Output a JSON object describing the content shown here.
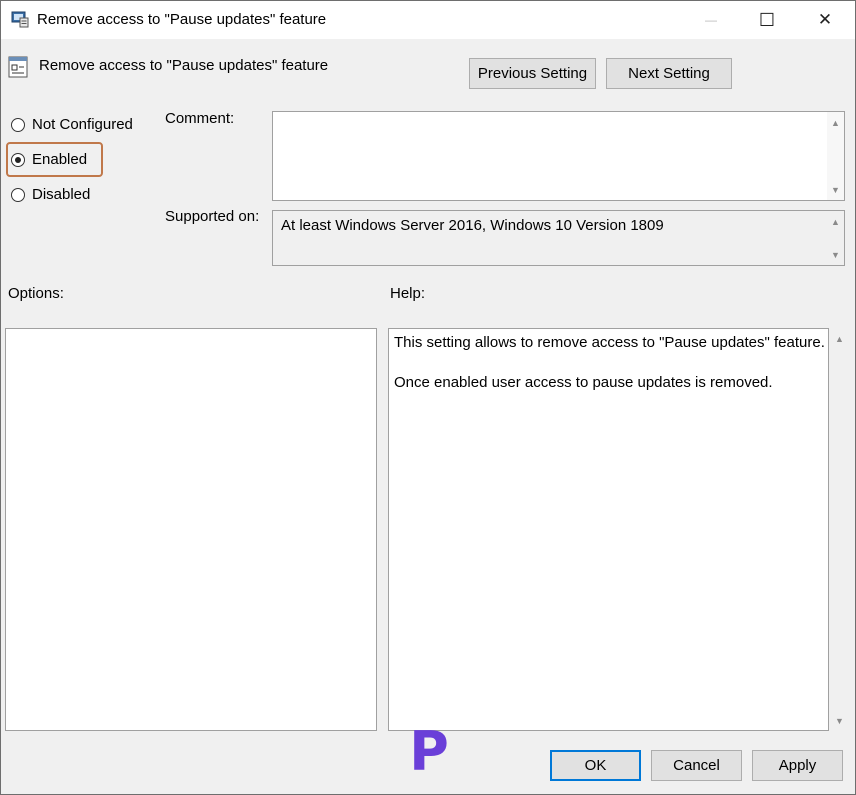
{
  "window": {
    "title": "Remove access to \"Pause updates\" feature",
    "minimize_glyph": "—",
    "maximize_glyph": "☐",
    "close_glyph": "✕",
    "icon": "policy-settings-icon"
  },
  "header": {
    "title": "Remove access to \"Pause updates\" feature",
    "icon": "policy-setting-icon"
  },
  "nav": {
    "previous_label": "Previous Setting",
    "next_label": "Next Setting"
  },
  "state": {
    "options": [
      {
        "label": "Not Configured",
        "checked": false
      },
      {
        "label": "Enabled",
        "checked": true
      },
      {
        "label": "Disabled",
        "checked": false
      }
    ],
    "highlight_color": "#c0784a"
  },
  "comment": {
    "label": "Comment:",
    "value": ""
  },
  "supported": {
    "label": "Supported on:",
    "value": "At least Windows Server 2016, Windows 10 Version 1809"
  },
  "options_panel": {
    "label": "Options:"
  },
  "help_panel": {
    "label": "Help:",
    "paragraphs": [
      "This setting allows to remove access to \"Pause updates\" feature.",
      "Once enabled user access to pause updates is removed."
    ]
  },
  "footer": {
    "ok_label": "OK",
    "cancel_label": "Cancel",
    "apply_label": "Apply"
  },
  "watermark": {
    "text": "P",
    "color": "#6a3fd8"
  },
  "colors": {
    "accent": "#0078d7",
    "dialog_bg": "#f0f0f0"
  }
}
